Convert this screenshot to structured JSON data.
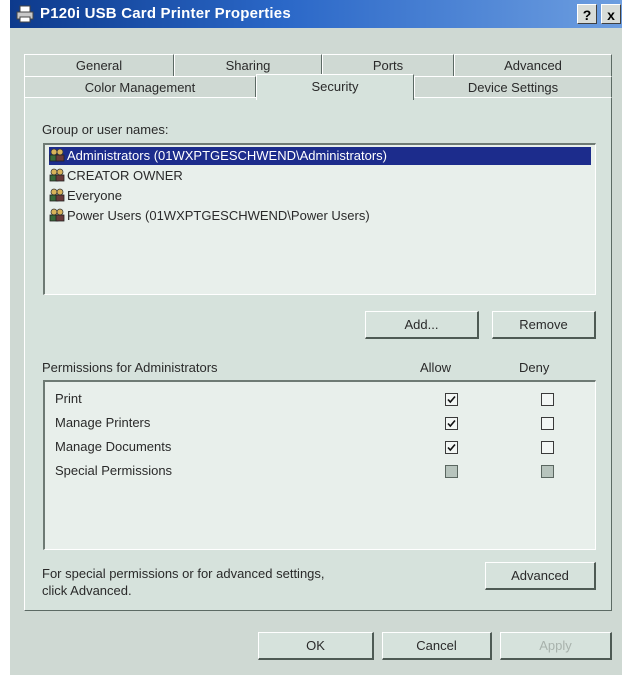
{
  "window": {
    "title": "P120i USB Card Printer Properties",
    "help_label": "?",
    "close_label": "x"
  },
  "tabs": {
    "row1": [
      {
        "label": "General"
      },
      {
        "label": "Sharing"
      },
      {
        "label": "Ports"
      },
      {
        "label": "Advanced"
      }
    ],
    "row2": [
      {
        "label": "Color Management"
      },
      {
        "label": "Security"
      },
      {
        "label": "Device Settings"
      }
    ],
    "active": "Security"
  },
  "security": {
    "group_label": "Group or user names:",
    "users": [
      {
        "name": "Administrators (01WXPTGESCHWEND\\Administrators)",
        "selected": true
      },
      {
        "name": "CREATOR OWNER",
        "selected": false
      },
      {
        "name": "Everyone",
        "selected": false
      },
      {
        "name": "Power Users (01WXPTGESCHWEND\\Power Users)",
        "selected": false
      }
    ],
    "add_label": "Add...",
    "remove_label": "Remove",
    "permissions_label": "Permissions for Administrators",
    "allow_label": "Allow",
    "deny_label": "Deny",
    "permissions": [
      {
        "name": "Print",
        "allow": "checked",
        "deny": "unchecked"
      },
      {
        "name": "Manage Printers",
        "allow": "checked",
        "deny": "unchecked"
      },
      {
        "name": "Manage Documents",
        "allow": "checked",
        "deny": "unchecked"
      },
      {
        "name": "Special Permissions",
        "allow": "disabled",
        "deny": "disabled"
      }
    ],
    "advanced_text_line1": "For special permissions or for advanced settings,",
    "advanced_text_line2": "click Advanced.",
    "advanced_label": "Advanced"
  },
  "footer": {
    "ok_label": "OK",
    "cancel_label": "Cancel",
    "apply_label": "Apply"
  },
  "colors": {
    "title_bar": "#0d3a8c",
    "selection": "#1c2c8c",
    "dialog_bg": "#cfd9d3"
  }
}
